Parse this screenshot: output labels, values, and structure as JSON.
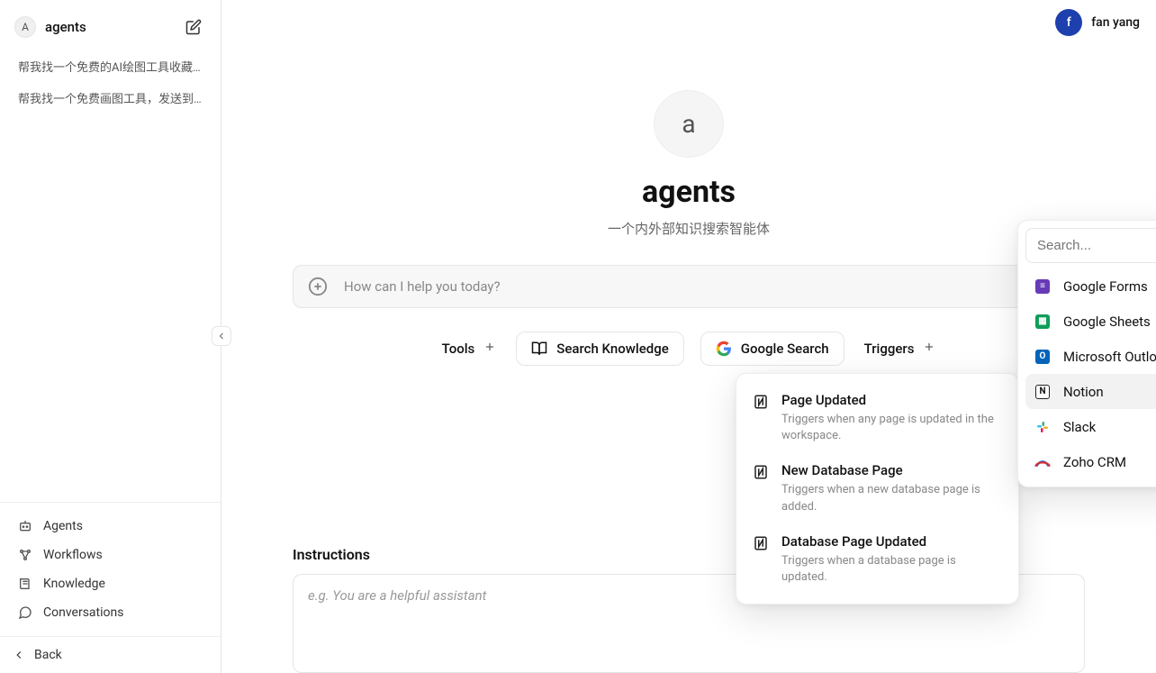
{
  "sidebar": {
    "avatar_letter": "A",
    "title": "agents",
    "history": [
      "帮我找一个免费的AI绘图工具收藏到邮箱",
      "帮我找一个免费画图工具，发送到我的邮件"
    ],
    "nav": {
      "agents": "Agents",
      "workflows": "Workflows",
      "knowledge": "Knowledge",
      "conversations": "Conversations"
    },
    "back": "Back"
  },
  "user": {
    "avatar_letter": "f",
    "name": "fan yang"
  },
  "agent": {
    "avatar_letter": "a",
    "title": "agents",
    "subtitle": "一个内外部知识搜索智能体",
    "prompt_placeholder": "How can I help you today?"
  },
  "actions": {
    "tools": "Tools",
    "search_knowledge": "Search Knowledge",
    "google_search": "Google Search",
    "triggers": "Triggers"
  },
  "instructions": {
    "label": "Instructions",
    "placeholder": "e.g. You are a helpful assistant"
  },
  "triggers_popover": {
    "items": [
      {
        "title": "Page Updated",
        "desc": "Triggers when any page is updated in the workspace."
      },
      {
        "title": "New Database Page",
        "desc": "Triggers when a new database page is added."
      },
      {
        "title": "Database Page Updated",
        "desc": "Triggers when a database page is updated."
      }
    ]
  },
  "integrations_popover": {
    "search_placeholder": "Search...",
    "items": [
      {
        "name": "Google Forms"
      },
      {
        "name": "Google Sheets"
      },
      {
        "name": "Microsoft Outlook"
      },
      {
        "name": "Notion",
        "selected": true
      },
      {
        "name": "Slack"
      },
      {
        "name": "Zoho CRM"
      }
    ]
  }
}
